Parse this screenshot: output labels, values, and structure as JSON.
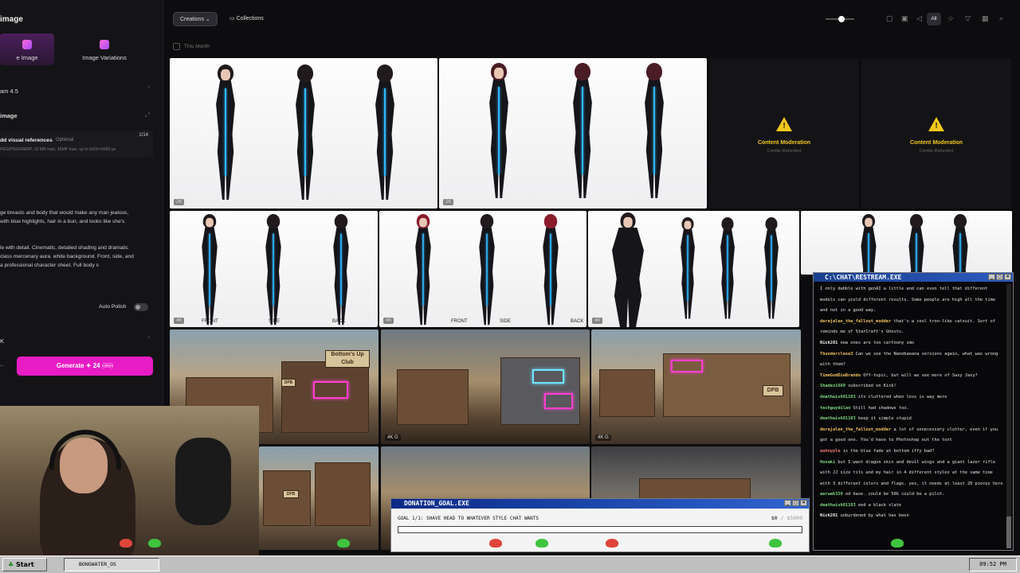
{
  "left_panel": {
    "title": "image",
    "mode_tabs": [
      {
        "label": "e Image",
        "active": true
      },
      {
        "label": "Image Variations",
        "active": false
      }
    ],
    "model": "am 4.5",
    "section_image": "image",
    "refs_label": "dd visual references",
    "refs_optional": "Optional",
    "refs_count": "1/14",
    "refs_hint": "PEG/PNG/WEBP, 10 MB max, 36MP max, up to 6000×6000 px",
    "prompt_lines": [
      "ge breasts and body that would make any man jealous,",
      " with blue highlights, hair in a bun, and looks like she's",
      "",
      "",
      "le with detail. Cinematic, detailed shading and dramatic",
      "class mercenary aura. white background. Front, side, and",
      "a professional character sheet. Full body s"
    ],
    "auto_polish_label": "Auto Polish",
    "resolution": "K",
    "generate_label": "Generate",
    "generate_cost": "24",
    "generate_cost_old": "(30)"
  },
  "topbar": {
    "creations_label": "Creations",
    "collections_label": "Collections",
    "all_label": "All"
  },
  "filter": {
    "month_label": "This Month"
  },
  "tiles": {
    "badge_2k": "2K",
    "badge_4k": "4K",
    "moderation_title": "Content Moderation",
    "moderation_sub": "Credits Refunded",
    "sheet_labels": [
      "FRONT",
      "SIDE",
      "BACK"
    ],
    "sign_text": "Bottom's Up Club",
    "dpb_text": "DPB",
    "g_badge": "G"
  },
  "chat": {
    "title": "C:\\CHAT\\RESTREAM.EXE",
    "messages": [
      {
        "user": "",
        "text": "I only dabble with genAI a little and can even tell that different models can yield different results. Some people are high all the time and not in a good way.",
        "color": "#7fd77f"
      },
      {
        "user": "derejalen_the_fallout_modder",
        "text": "that's a cool tron-like catsuit. Sort of reminds me of StarCraft's Ghosts.",
        "color": "#f0c05a"
      },
      {
        "user": "Nick281",
        "text": "new ones are too cartoony imo",
        "color": "#f3f3f3"
      },
      {
        "user": "Thunderclese3",
        "text": "Can we see the Nanobanana versions again, what was wrong with them?",
        "color": "#f0c05a"
      },
      {
        "user": "TimeGodDieBrando",
        "text": "Off-topic, but will we see more of Saxy Jaxy?",
        "color": "#f0c05a"
      },
      {
        "user": "Shadez1669",
        "text": "subscribed on Kick!",
        "color": "#7fd77f"
      },
      {
        "user": "deathwish01103",
        "text": "its cluttered when less is way more",
        "color": "#7fd77f"
      },
      {
        "user": "techguydilan",
        "text": "Still had shadows too.",
        "color": "#7fd77f"
      },
      {
        "user": "deathwish01103",
        "text": "keep it simple stupid",
        "color": "#7fd77f"
      },
      {
        "user": "derejalen_the_fallout_modder",
        "text": "a lot of unnecessary clutter, even if you got a good one. You'd have to Photoshop out the text",
        "color": "#f0c05a"
      },
      {
        "user": "auhnyple",
        "text": "is the blue fade at bottom iffy bad?",
        "color": "#f07a7a"
      },
      {
        "user": "Hosaki",
        "text": "but I want dragon skin and devil wings and a giant lazer rifle with JJ size tits and my hair in 4 different styles at the same time with 3 different colors and flags. yes, it needs at least 20 pieces here",
        "color": "#7fd77f"
      },
      {
        "user": "aerwak359",
        "text": "od base. could be 50G could be a pilot.",
        "color": "#7fd77f"
      },
      {
        "user": "deathwish01103",
        "text": "eed a black slate",
        "color": "#7fd77f"
      },
      {
        "user": "Nick281",
        "text": "unburdened by what has been",
        "color": "#f3f3f3"
      }
    ]
  },
  "donation": {
    "title": "DONATION_GOAL.EXE",
    "goal_text": "GOAL 1/1: SHAVE HEAD TO WHATEVER STYLE CHAT WANTS",
    "current": "$0",
    "target": "/ $5000",
    "progress_fraction": 0.0
  },
  "taskbar": {
    "start_label": "Start",
    "task_label": "BONGWATER_OS",
    "clock": "09:52 PM"
  }
}
